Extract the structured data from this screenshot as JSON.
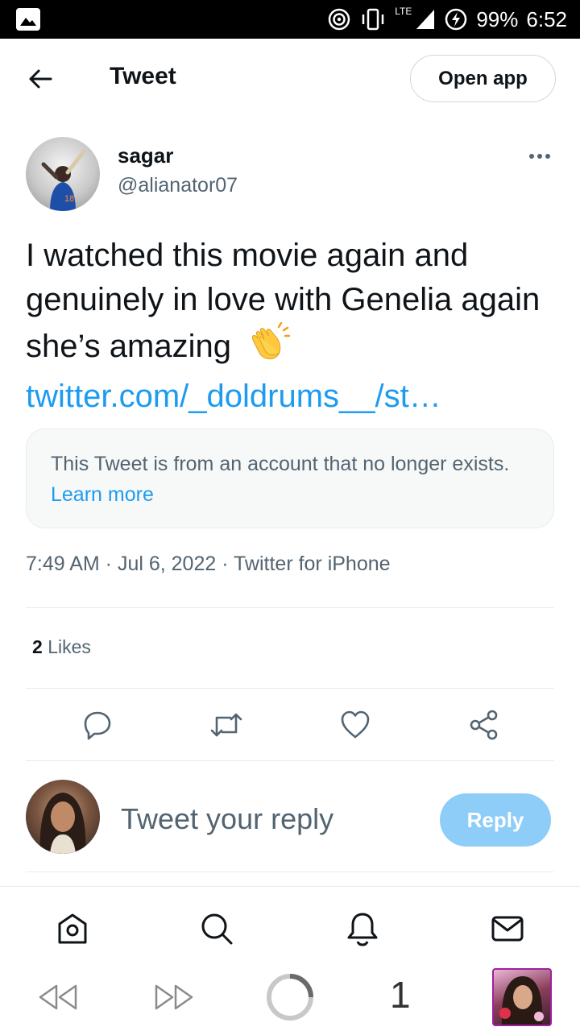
{
  "status_bar": {
    "network": "LTE",
    "battery": "99%",
    "time": "6:52"
  },
  "header": {
    "title": "Tweet",
    "open_app_label": "Open app"
  },
  "tweet": {
    "author_name": "sagar",
    "author_handle": "@alianator07",
    "text": "I watched this movie again and genuinely in love with Genelia again she’s amazing",
    "emoji": "clapping-hands",
    "link_text": "twitter.com/_doldrums__/st…",
    "quote_notice": "This Tweet is from an account that no longer exists.",
    "quote_learn_more": "Learn more",
    "timestamp": "7:49 AM · Jul 6, 2022 · Twitter for iPhone",
    "likes_count": "2",
    "likes_label": "Likes"
  },
  "actions": {
    "icons": [
      "reply-icon",
      "retweet-icon",
      "like-icon",
      "share-icon"
    ]
  },
  "reply": {
    "placeholder": "Tweet your reply",
    "button_label": "Reply"
  },
  "tab_bar": {
    "icons": [
      "home-icon",
      "search-icon",
      "notifications-icon",
      "messages-icon"
    ]
  },
  "nav_bar": {
    "tab_count": "1"
  },
  "colors": {
    "accent": "#1d9bf0",
    "reply_button_disabled": "#8ecdf8",
    "secondary_text": "#536471",
    "primary_text": "#0f1419",
    "divider": "#e6ecf0"
  }
}
